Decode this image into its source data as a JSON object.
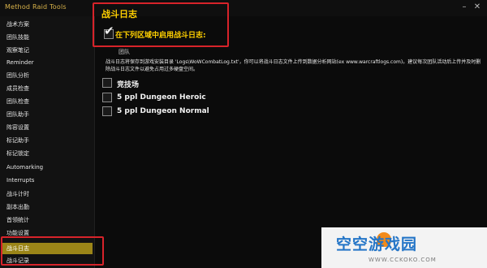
{
  "app": {
    "title": "Method Raid Tools",
    "minimize": "–",
    "close": "✕"
  },
  "sidebar": {
    "items": [
      {
        "label": "战术方案",
        "top": 0
      },
      {
        "label": "团队技能"
      },
      {
        "label": "观察笔记"
      },
      {
        "label": "Reminder"
      },
      {
        "label": "团队分析"
      },
      {
        "label": "成员检查"
      },
      {
        "label": "团队检查"
      },
      {
        "label": "团队助手"
      },
      {
        "label": "阵容设置"
      },
      {
        "label": "标记助手"
      },
      {
        "label": "标记锁定"
      },
      {
        "label": "Automarking"
      },
      {
        "label": "Interrupts"
      },
      {
        "label": "战斗计时"
      },
      {
        "label": "副本出勤"
      },
      {
        "label": "首领统计"
      },
      {
        "label": "功能设置"
      },
      {
        "label": "战斗日志"
      },
      {
        "label": "战斗记录"
      }
    ],
    "selected_label": "战斗日志"
  },
  "content": {
    "title": "战斗日志",
    "enable_checkbox_label": "在下列区域中启用战斗日志:",
    "enable_checked": true,
    "group_label": "团队",
    "description": "战斗日志将保存到游戏安装目录 'Logs\\WoWCombatLog.txt'，你可以将战斗日志文件上传到数据分析网站(ex www.warcraftlogs.com)。建议每次团队活动后上传并及时删除战斗日志文件以避免占用过多硬盘空间。",
    "options": [
      {
        "label": "竞技场",
        "checked": false
      },
      {
        "label": "5 ppl Dungeon Heroic",
        "checked": false
      },
      {
        "label": "5 ppl Dungeon Normal",
        "checked": false
      }
    ]
  },
  "watermark": {
    "text": "空空游戏园",
    "url": "WWW.CCKOKO.COM"
  },
  "colors": {
    "accent": "#ffd000",
    "selection": "#9b8518",
    "highlight": "#d7232a",
    "watermark_blue": "#2475c7"
  },
  "icons": {
    "check": "checkmark-icon"
  }
}
